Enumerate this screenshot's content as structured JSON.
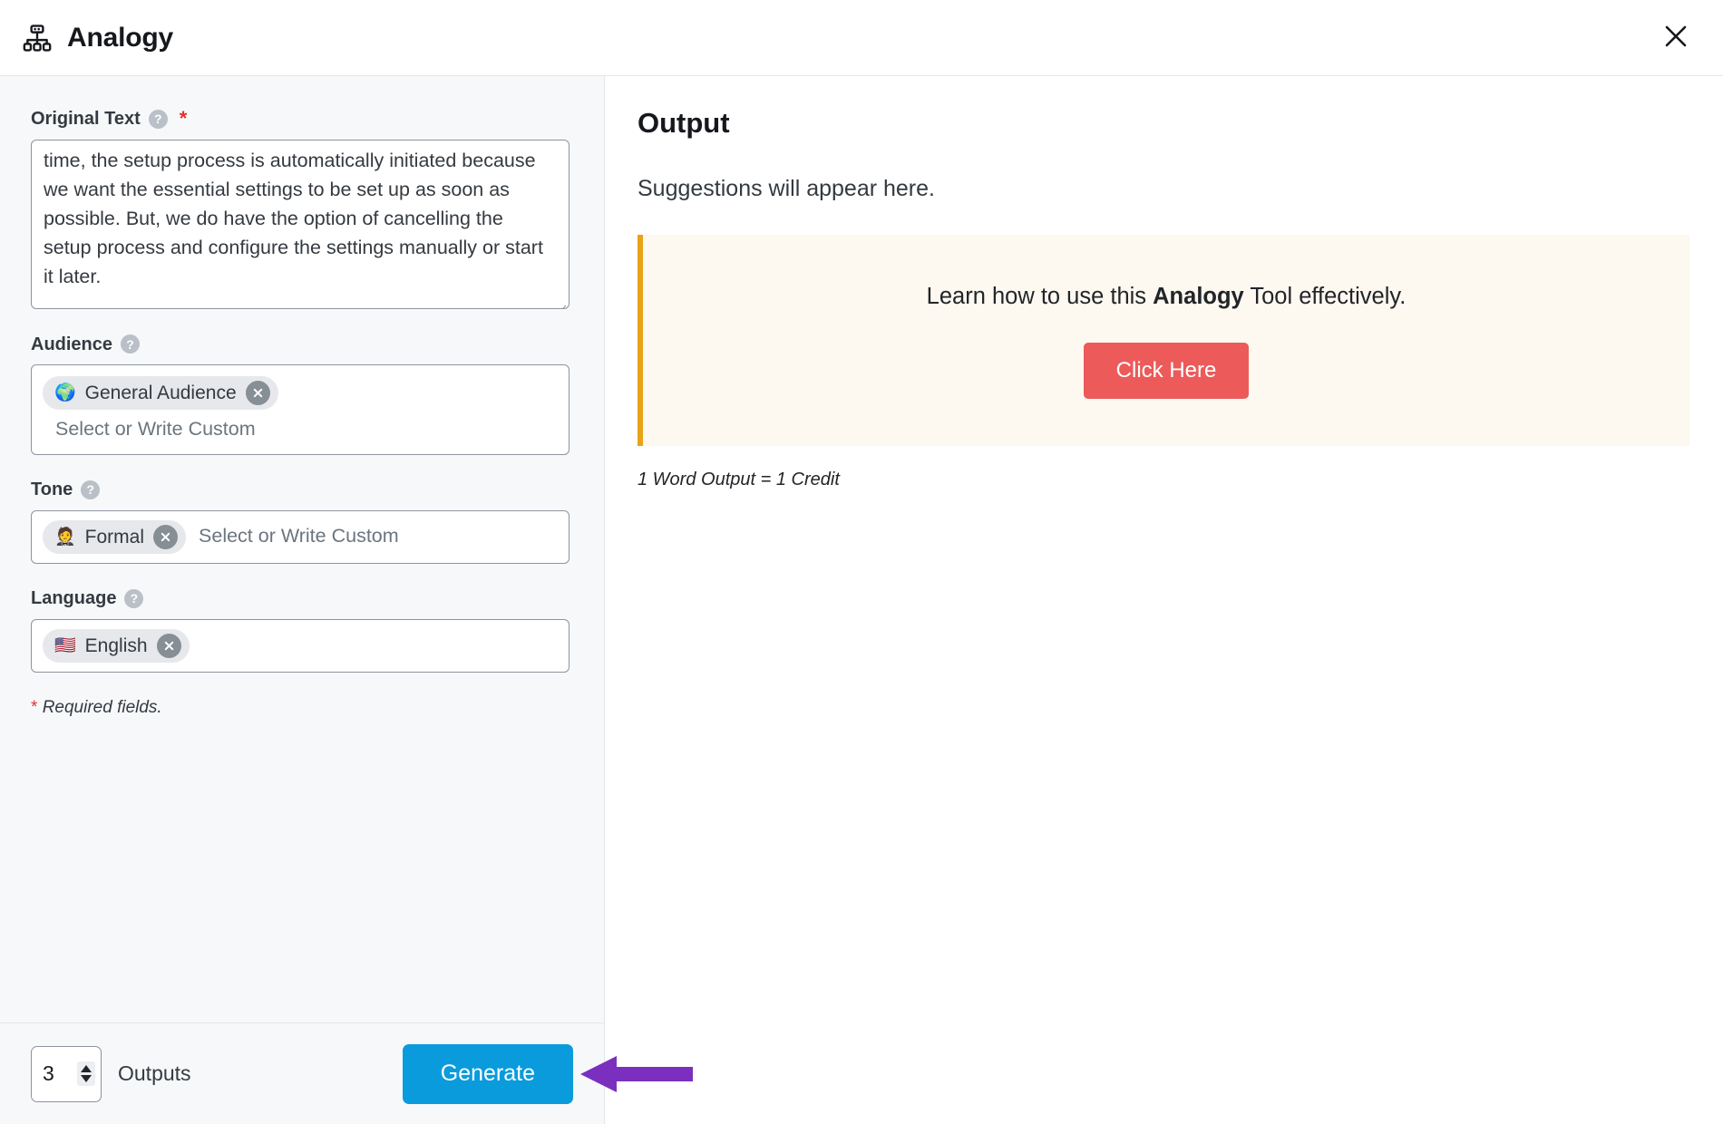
{
  "header": {
    "title": "Analogy",
    "icon": "sitemap-icon",
    "close_label": "×"
  },
  "form": {
    "original_text": {
      "label": "Original Text",
      "help": "?",
      "required_marker": "*",
      "value": "time, the setup process is automatically initiated because we want the essential settings to be set up as soon as possible. But, we do have the option of cancelling the setup process and configure the settings manually or start it later."
    },
    "audience": {
      "label": "Audience",
      "help": "?",
      "chips": [
        {
          "emoji": "🌍",
          "label": "General Audience",
          "remove": "remove-chip"
        }
      ],
      "placeholder": "Select or Write Custom"
    },
    "tone": {
      "label": "Tone",
      "help": "?",
      "chips": [
        {
          "emoji": "🤵",
          "label": "Formal",
          "remove": "remove-chip"
        }
      ],
      "placeholder": "Select or Write Custom"
    },
    "language": {
      "label": "Language",
      "help": "?",
      "chips": [
        {
          "emoji": "🇺🇸",
          "label": "English",
          "remove": "remove-chip"
        }
      ],
      "placeholder": ""
    },
    "required_note_star": "*",
    "required_note": "Required fields."
  },
  "footer": {
    "outputs_value": "3",
    "outputs_label": "Outputs",
    "generate_label": "Generate"
  },
  "output": {
    "title": "Output",
    "empty_state": "Suggestions will appear here.",
    "callout_pre": "Learn how to use this ",
    "callout_bold": "Analogy",
    "callout_post": " Tool effectively.",
    "callout_button": "Click Here",
    "credit_note": "1 Word Output = 1 Credit"
  },
  "colors": {
    "accent_blue": "#0a9bdd",
    "callout_border": "#e8a317",
    "callout_bg": "#fdf8f0",
    "danger_red": "#ec5a5a",
    "required_red": "#e03131",
    "annotation_purple": "#7b2fbe",
    "panel_bg": "#f7f8fa"
  }
}
